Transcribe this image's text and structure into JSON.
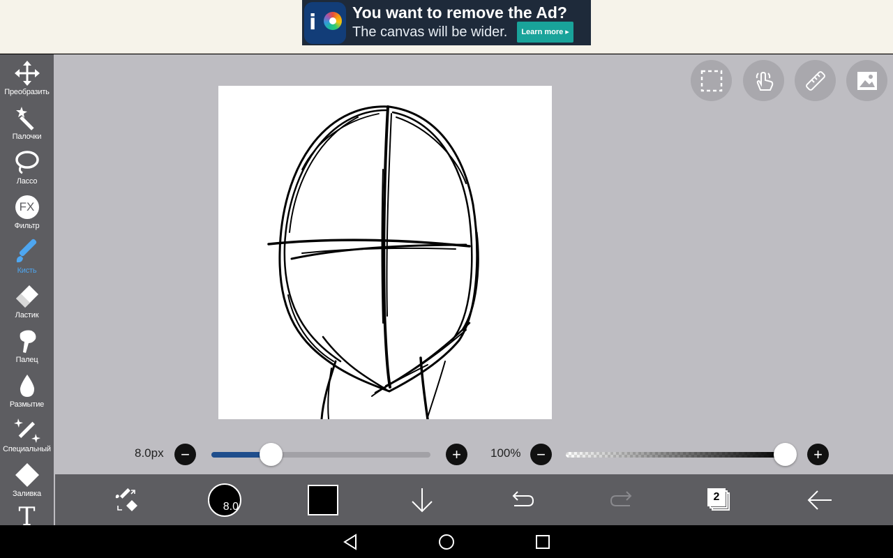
{
  "ad": {
    "title": "You want to remove the Ad?",
    "subtitle": "The canvas will be wider.",
    "cta": "Learn more ▸",
    "logo_icon": "ibispaint-logo-icon"
  },
  "toolbar": {
    "items": [
      {
        "label": "Преобразить",
        "icon": "move-arrows-icon"
      },
      {
        "label": "Палочки",
        "icon": "magic-wand-icon"
      },
      {
        "label": "Лассо",
        "icon": "lasso-icon"
      },
      {
        "label": "Фильтр",
        "icon": "fx-filter-icon",
        "glyph": "FX"
      },
      {
        "label": "Кисть",
        "icon": "brush-icon",
        "active": true
      },
      {
        "label": "Ластик",
        "icon": "eraser-icon"
      },
      {
        "label": "Палец",
        "icon": "smudge-finger-icon"
      },
      {
        "label": "Размытие",
        "icon": "blur-drop-icon"
      },
      {
        "label": "Специальный",
        "icon": "special-pen-icon"
      },
      {
        "label": "Заливка",
        "icon": "fill-bucket-icon"
      },
      {
        "label": "",
        "icon": "text-tool-icon",
        "glyph": "T"
      }
    ],
    "active_color": "#4ea6f0"
  },
  "top_buttons": [
    {
      "icon": "selection-marquee-icon"
    },
    {
      "icon": "hand-touch-icon"
    },
    {
      "icon": "ruler-icon"
    },
    {
      "icon": "reference-image-icon"
    }
  ],
  "brush": {
    "size_label": "8.0px",
    "size_value": 8.0,
    "size_fraction": 0.27,
    "opacity_label": "100%",
    "opacity_fraction": 1.0,
    "minus": "−",
    "plus": "+"
  },
  "bottom": {
    "brush_preview_label": "8.0",
    "current_color": "#000000",
    "layer_count": "2"
  }
}
